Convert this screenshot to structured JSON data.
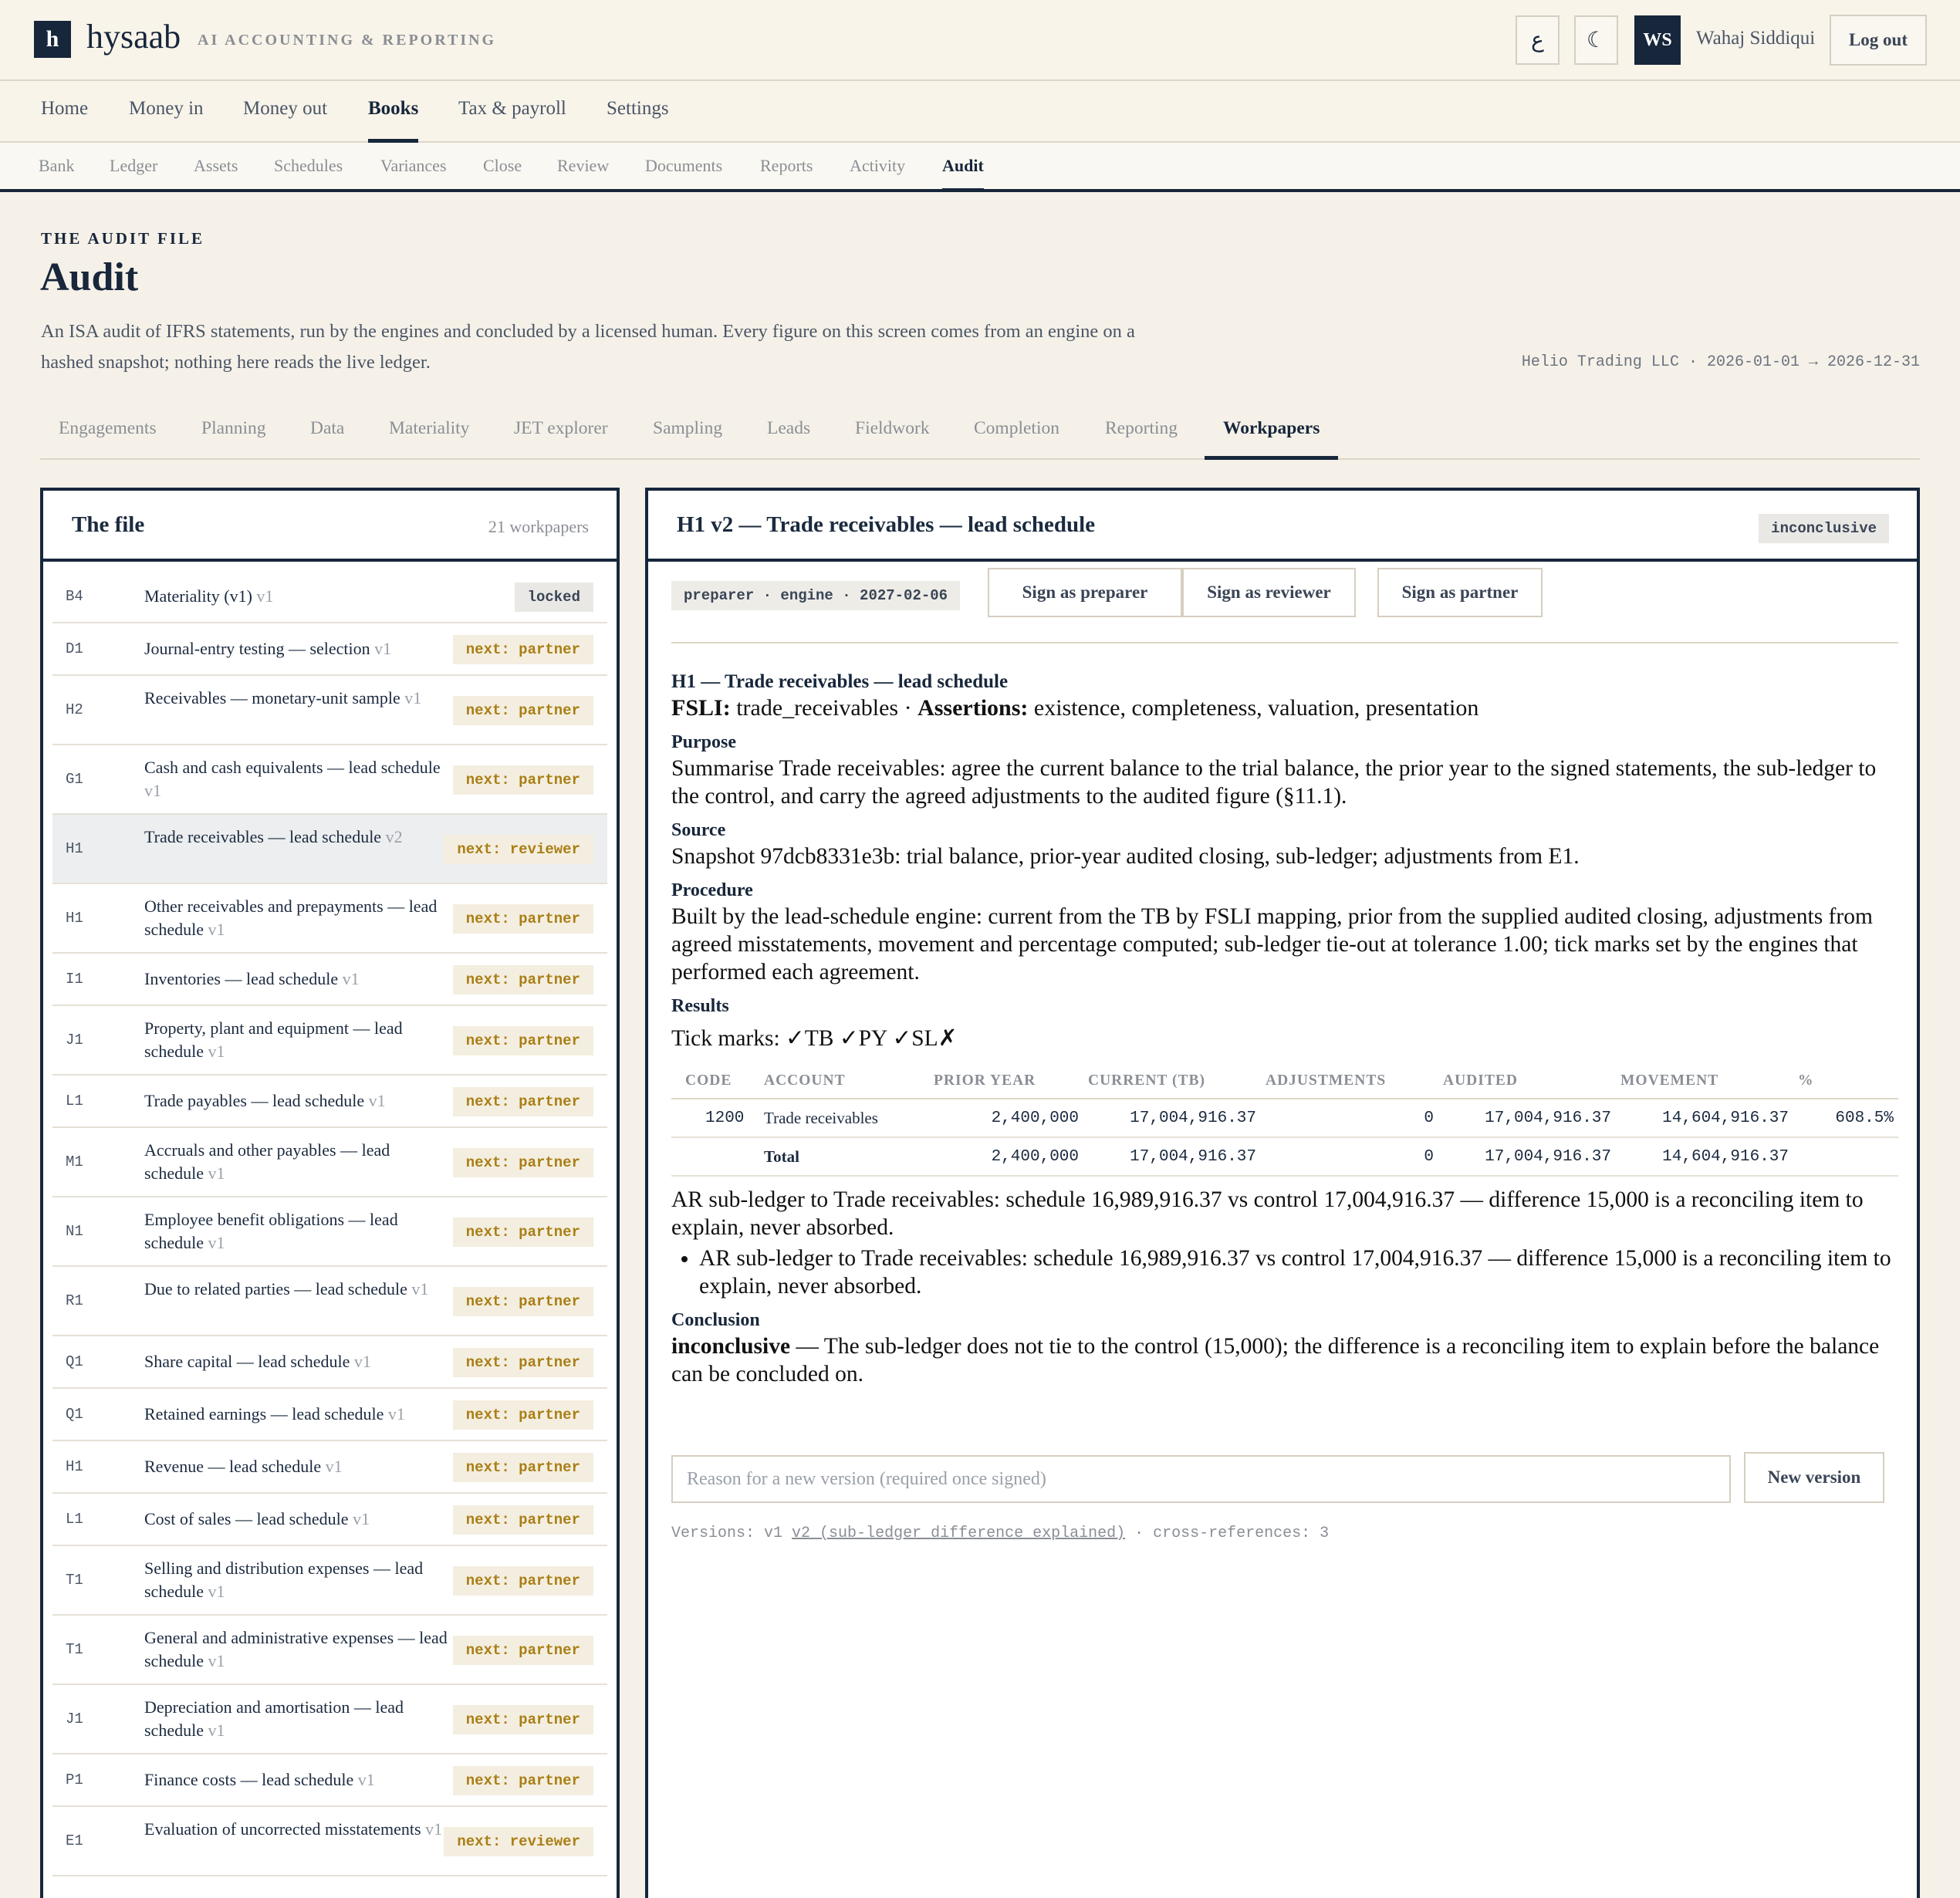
{
  "brand": {
    "logo_letter": "h",
    "name": "hysaab",
    "tagline": "AI ACCOUNTING & REPORTING"
  },
  "topbar": {
    "lang_icon": "ع",
    "theme_icon": "☾",
    "avatar_initials": "WS",
    "user_name": "Wahaj Siddiqui",
    "logout_label": "Log out"
  },
  "main_nav": [
    "Home",
    "Money in",
    "Money out",
    "Books",
    "Tax & payroll",
    "Settings"
  ],
  "main_nav_active": "Books",
  "sub_nav": [
    "Bank",
    "Ledger",
    "Assets",
    "Schedules",
    "Variances",
    "Close",
    "Review",
    "Documents",
    "Reports",
    "Activity",
    "Audit"
  ],
  "sub_nav_active": "Audit",
  "header": {
    "eyebrow": "THE AUDIT FILE",
    "title": "Audit",
    "description": "An ISA audit of IFRS statements, run by the engines and concluded by a licensed human. Every figure on this screen comes from an engine on a hashed snapshot; nothing here reads the live ledger.",
    "scope": "Helio Trading LLC · 2026-01-01 → 2026-12-31"
  },
  "audit_tabs": [
    "Engagements",
    "Planning",
    "Data",
    "Materiality",
    "JET explorer",
    "Sampling",
    "Leads",
    "Fieldwork",
    "Completion",
    "Reporting",
    "Workpapers"
  ],
  "audit_tabs_active": "Workpapers",
  "file_panel": {
    "title": "The file",
    "count": "21 workpapers",
    "workpapers": [
      {
        "code": "B4",
        "title": "Materiality (v1)",
        "ver": "v1",
        "badge": "locked"
      },
      {
        "code": "D1",
        "title": "Journal-entry testing — selection",
        "ver": "v1",
        "badge": "next: partner"
      },
      {
        "code": "H2",
        "title": "Receivables — monetary-unit sample",
        "ver": "v1",
        "badge": "next: partner"
      },
      {
        "code": "G1",
        "title": "Cash and cash equivalents — lead schedule",
        "ver": "v1",
        "badge": "next: partner"
      },
      {
        "code": "H1",
        "title": "Trade receivables — lead schedule",
        "ver": "v2",
        "badge": "next: reviewer",
        "selected": true
      },
      {
        "code": "H1",
        "title": "Other receivables and prepayments — lead schedule",
        "ver": "v1",
        "badge": "next: partner"
      },
      {
        "code": "I1",
        "title": "Inventories — lead schedule",
        "ver": "v1",
        "badge": "next: partner"
      },
      {
        "code": "J1",
        "title": "Property, plant and equipment — lead schedule",
        "ver": "v1",
        "badge": "next: partner"
      },
      {
        "code": "L1",
        "title": "Trade payables — lead schedule",
        "ver": "v1",
        "badge": "next: partner"
      },
      {
        "code": "M1",
        "title": "Accruals and other payables — lead schedule",
        "ver": "v1",
        "badge": "next: partner"
      },
      {
        "code": "N1",
        "title": "Employee benefit obligations — lead schedule",
        "ver": "v1",
        "badge": "next: partner"
      },
      {
        "code": "R1",
        "title": "Due to related parties — lead schedule",
        "ver": "v1",
        "badge": "next: partner"
      },
      {
        "code": "Q1",
        "title": "Share capital — lead schedule",
        "ver": "v1",
        "badge": "next: partner"
      },
      {
        "code": "Q1",
        "title": "Retained earnings — lead schedule",
        "ver": "v1",
        "badge": "next: partner"
      },
      {
        "code": "H1",
        "title": "Revenue — lead schedule",
        "ver": "v1",
        "badge": "next: partner"
      },
      {
        "code": "L1",
        "title": "Cost of sales — lead schedule",
        "ver": "v1",
        "badge": "next: partner"
      },
      {
        "code": "T1",
        "title": "Selling and distribution expenses — lead schedule",
        "ver": "v1",
        "badge": "next: partner"
      },
      {
        "code": "T1",
        "title": "General and administrative expenses — lead schedule",
        "ver": "v1",
        "badge": "next: partner"
      },
      {
        "code": "J1",
        "title": "Depreciation and amortisation — lead schedule",
        "ver": "v1",
        "badge": "next: partner"
      },
      {
        "code": "P1",
        "title": "Finance costs — lead schedule",
        "ver": "v1",
        "badge": "next: partner"
      },
      {
        "code": "E1",
        "title": "Evaluation of uncorrected misstatements",
        "ver": "v1",
        "badge": "next: reviewer"
      }
    ]
  },
  "workpaper": {
    "title": "H1 v2 — Trade receivables — lead schedule",
    "status": "inconclusive",
    "meta": "preparer · engine · 2027-02-06",
    "sign_preparer": "Sign as preparer",
    "sign_reviewer": "Sign as reviewer",
    "sign_partner": "Sign as partner",
    "heading": "H1 — Trade receivables — lead schedule",
    "fsli_label": "FSLI:",
    "fsli_value": "trade_receivables",
    "assertions_label": "Assertions:",
    "assertions_value": "existence, completeness, valuation, presentation",
    "purpose_label": "Purpose",
    "purpose": "Summarise Trade receivables: agree the current balance to the trial balance, the prior year to the signed statements, the sub-ledger to the control, and carry the agreed adjustments to the audited figure (§11.1).",
    "source_label": "Source",
    "source": "Snapshot 97dcb8331e3b: trial balance, prior-year audited closing, sub-ledger; adjustments from E1.",
    "procedure_label": "Procedure",
    "procedure": "Built by the lead-schedule engine: current from the TB by FSLI mapping, prior from the supplied audited closing, adjustments from agreed misstatements, movement and percentage computed; sub-ledger tie-out at tolerance 1.00; tick marks set by the engines that performed each agreement.",
    "results_label": "Results",
    "tick_marks": "Tick marks: ✓TB ✓PY ✓SL✗",
    "table": {
      "headers": [
        "CODE",
        "ACCOUNT",
        "PRIOR YEAR",
        "CURRENT (TB)",
        "ADJUSTMENTS",
        "AUDITED",
        "MOVEMENT",
        "%"
      ],
      "rows": [
        {
          "code": "1200",
          "account": "Trade receivables",
          "prior": "2,400,000",
          "current": "17,004,916.37",
          "adj": "0",
          "audited": "17,004,916.37",
          "movement": "14,604,916.37",
          "pct": "608.5%"
        }
      ],
      "total": {
        "label": "Total",
        "prior": "2,400,000",
        "current": "17,004,916.37",
        "adj": "0",
        "audited": "17,004,916.37",
        "movement": "14,604,916.37"
      }
    },
    "tieout_note": "AR sub-ledger to Trade receivables: schedule 16,989,916.37 vs control 17,004,916.37 — difference 15,000 is a reconciling item to explain, never absorbed.",
    "tieout_bullet": "AR sub-ledger to Trade receivables: schedule 16,989,916.37 vs control 17,004,916.37 — difference 15,000 is a reconciling item to explain, never absorbed.",
    "conclusion_label": "Conclusion",
    "conclusion_word": "inconclusive",
    "conclusion_text": " — The sub-ledger does not tie to the control (15,000); the difference is a reconciling item to explain before the balance can be concluded on.",
    "reason_placeholder": "Reason for a new version (required once signed)",
    "new_version_label": "New version",
    "versions_prefix": "Versions: v1",
    "versions_link": "v2 (sub-ledger difference explained)",
    "versions_suffix": "· cross-references: 3"
  }
}
